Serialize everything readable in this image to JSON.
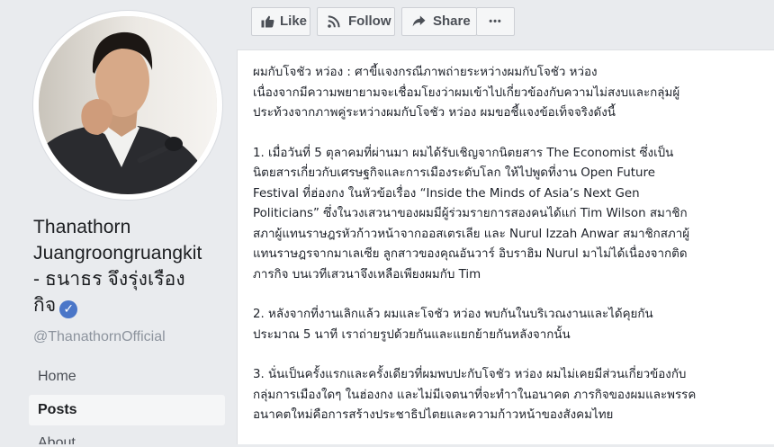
{
  "page": {
    "name_line1": "Thanathorn",
    "name_line2": "Juangroongruangkit",
    "name_line3": "- ธนาธร จึงรุ่งเรือง",
    "name_line4": "กิจ",
    "verified_glyph": "✓",
    "handle": "@ThanathornOfficial"
  },
  "nav": {
    "items": [
      "Home",
      "Posts",
      "About"
    ],
    "active": "Posts"
  },
  "actions": {
    "like": "Like",
    "follow": "Follow",
    "share": "Share",
    "more": "•••"
  },
  "post": {
    "paragraphs": [
      "ผมกับโจชัว หว่อง : ศาขี้แจงกรณีภาพถ่ายระหว่างผมกับโจชัว หว่อง\nเนื่องจากมีความพยายามจะเชื่อมโยงว่าผมเข้าไปเกี่ยวข้องกับความไม่สงบและกลุ่มผู้\nประท้วงจากภาพคู่ระหว่างผมกับโจชัว หว่อง ผมขอชี้แจงข้อเท็จจริงดังนี้",
      "1. เมื่อวันที่ 5 ตุลาคมที่ผ่านมา ผมได้รับเชิญจากนิตยสาร The Economist ซึ่งเป็น\nนิตยสารเกี่ยวกับเศรษฐกิจและการเมืองระดับโลก ให้ไปพูดที่งาน Open Future\nFestival ที่ฮ่องกง ในหัวข้อเรื่อง “Inside the Minds of Asia’s Next Gen\nPoliticians” ซึ่งในวงเสวนาของผมมีผู้ร่วมรายการสองคนได้แก่ Tim Wilson สมาชิก\nสภาผู้แทนราษฎรหัวก้าวหน้าจากออสเตรเลีย และ Nurul Izzah Anwar สมาชิกสภาผู้\nแทนราษฎรจากมาเลเซีย ลูกสาวของคุณอันวาร์ อิบราฮิม Nurul มาไม่ได้เนื่องจากติด\nภารกิจ บนเวทีเสวนาจึงเหลือเพียงผมกับ Tim",
      "2. หลังจากที่งานเลิกแล้ว ผมและโจชัว หว่อง พบกันในบริเวณงานและได้คุยกัน\nประมาณ 5 นาที เราถ่ายรูปด้วยกันและแยกย้ายกันหลังจากนั้น",
      "3. นั่นเป็นครั้งแรกและครั้งเดียวที่ผมพบปะกับโจชัว หว่อง ผมไม่เคยมีส่วนเกี่ยวข้องกับ\nกลุ่มการเมืองใดๆ ในฮ่องกง และไม่มีเจตนาที่จะทำาในอนาคต ภารกิจของผมและพรรค\nอนาคตใหม่คือการสร้างประชาธิปไตยและความก้าวหน้าของสังคมไทย"
    ]
  },
  "colors": {
    "page_bg": "#e9ebee",
    "verified": "#4a76c8",
    "handle": "#8d949e"
  }
}
